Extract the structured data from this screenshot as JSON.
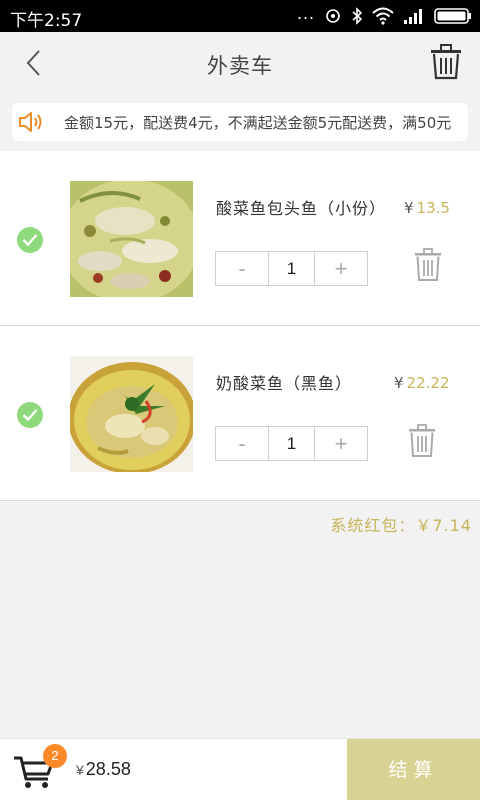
{
  "status_bar": {
    "time": "下午2:57",
    "dots": "..."
  },
  "nav": {
    "title": "外卖车",
    "back_icon": "back-icon",
    "trash_icon": "trash-icon"
  },
  "notice": {
    "icon": "speaker-icon",
    "text": "金额15元，配送费4元，不满起送金额5元配送费，满50元"
  },
  "items": [
    {
      "name": "酸菜鱼包头鱼（小份）",
      "currency": "¥",
      "price": "13.5",
      "quantity": "1",
      "minus": "-",
      "plus": "+",
      "checked": true
    },
    {
      "name": "奶酸菜鱼（黑鱼）",
      "currency": "¥",
      "price": "22.22",
      "quantity": "1",
      "minus": "-",
      "plus": "+",
      "checked": true
    }
  ],
  "red_packet": {
    "text": "系统红包：￥7.14"
  },
  "bottom": {
    "cart_count": "2",
    "currency": "¥",
    "total": "28.58",
    "checkout_label": "结算"
  },
  "colors": {
    "accent_gold": "#c8b45a",
    "check_green": "#8dd97c",
    "badge_orange": "#ff8a2a",
    "checkout_bg": "#d8d293"
  }
}
